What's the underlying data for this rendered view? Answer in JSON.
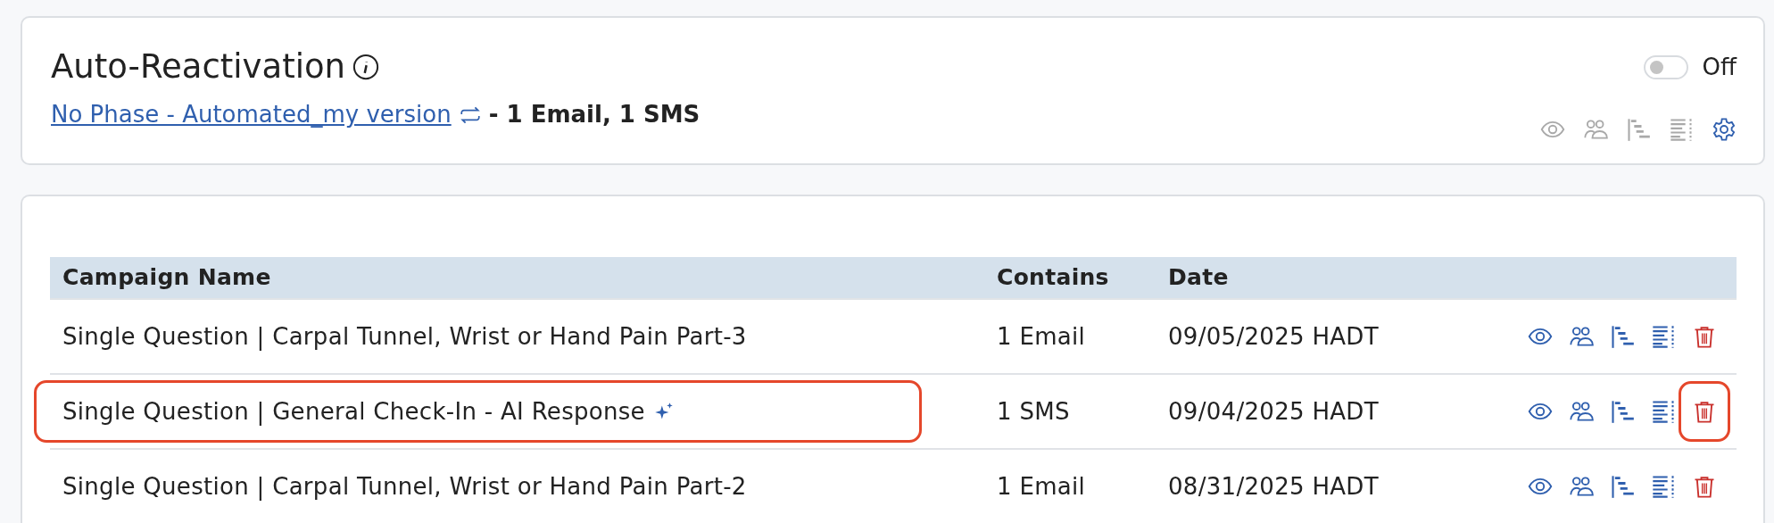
{
  "header": {
    "title": "Auto-Reactivation",
    "link": "No Phase - Automated_my version",
    "summary": "- 1 Email, 1 SMS",
    "toggle": {
      "on": false,
      "label": "Off"
    },
    "actions": [
      {
        "kind": "view",
        "disabled": true
      },
      {
        "kind": "people",
        "disabled": true
      },
      {
        "kind": "tree",
        "disabled": true
      },
      {
        "kind": "list",
        "disabled": true
      },
      {
        "kind": "settings",
        "disabled": false
      }
    ]
  },
  "table": {
    "columns": [
      "Campaign Name",
      "Contains",
      "Date"
    ],
    "rows": [
      {
        "name": "Single Question | Carpal Tunnel, Wrist or Hand Pain Part-3",
        "ai": false,
        "contains": "1 Email",
        "date": "09/05/2025 HADT",
        "name_circled": false,
        "delete_circled": false
      },
      {
        "name": "Single Question | General Check-In - AI Response",
        "ai": true,
        "contains": "1 SMS",
        "date": "09/04/2025 HADT",
        "name_circled": true,
        "delete_circled": true
      },
      {
        "name": "Single Question | Carpal Tunnel, Wrist or Hand Pain Part-2",
        "ai": false,
        "contains": "1 Email",
        "date": "08/31/2025 HADT",
        "name_circled": false,
        "delete_circled": false
      }
    ]
  }
}
